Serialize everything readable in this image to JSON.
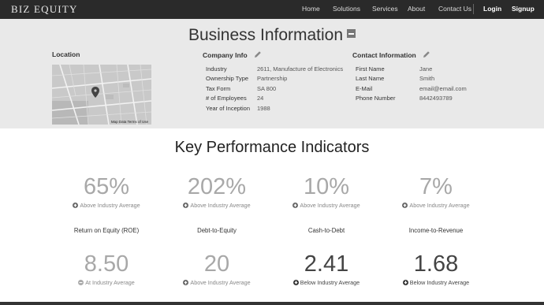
{
  "nav": {
    "logo": "BIZ EQUITY",
    "items": [
      "Home",
      "Solutions",
      "Services",
      "About",
      "Contact Us"
    ],
    "login": "Login",
    "signup": "Signup"
  },
  "business": {
    "title": "Business Information",
    "location_label": "Location",
    "map_credit": "Map Data   Terms of Use",
    "company": {
      "label": "Company Info",
      "rows": [
        {
          "key": "Industry",
          "value": "2611, Manufacture of Electronics"
        },
        {
          "key": "Ownership Type",
          "value": "Partnership"
        },
        {
          "key": "Tax Form",
          "value": "SA 800"
        },
        {
          "key": "# of Employees",
          "value": "24"
        },
        {
          "key": "Year of Inception",
          "value": "1988"
        }
      ]
    },
    "contact": {
      "label": "Contact Information",
      "rows": [
        {
          "key": "First Name",
          "value": "Jane"
        },
        {
          "key": "Last Name",
          "value": "Smith"
        },
        {
          "key": "E-Mail",
          "value": "email@email.com"
        },
        {
          "key": "Phone Number",
          "value": "8442493789"
        }
      ]
    }
  },
  "kpi": {
    "title": "Key Performance Indicators",
    "top_row": [
      {
        "value": "65%",
        "note": "Above Industry Average",
        "trend": "up"
      },
      {
        "value": "202%",
        "note": "Above Industry Average",
        "trend": "up"
      },
      {
        "value": "10%",
        "note": "Above Industry Average",
        "trend": "up"
      },
      {
        "value": "7%",
        "note": "Above Industry Average",
        "trend": "up"
      }
    ],
    "labels": [
      "Return on Equity (ROE)",
      "Debt-to-Equity",
      "Cash-to-Debt",
      "Income-to-Revenue"
    ],
    "bottom_row": [
      {
        "value": "8.50",
        "note": "At Industry Average",
        "trend": "at"
      },
      {
        "value": "20",
        "note": "Above Industry Average",
        "trend": "up"
      },
      {
        "value": "2.41",
        "note": "Below Industry Average",
        "trend": "down"
      },
      {
        "value": "1.68",
        "note": "Below Industry Average",
        "trend": "down"
      }
    ]
  }
}
